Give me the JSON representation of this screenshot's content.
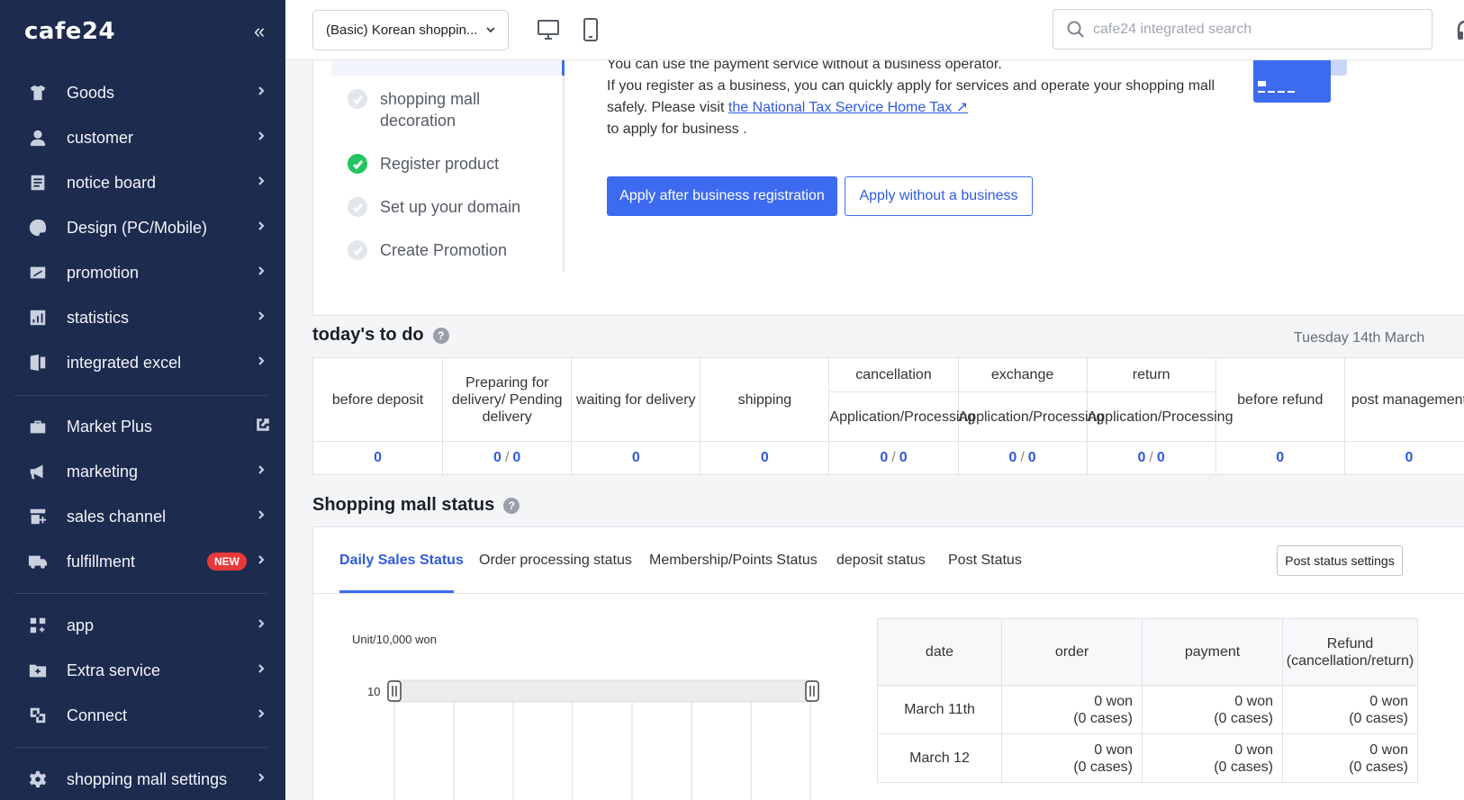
{
  "brand": {
    "logo": "cafe24",
    "collapse": "«"
  },
  "sidebar": {
    "items": [
      {
        "label": "Goods",
        "icon": "shirt-icon"
      },
      {
        "label": "customer",
        "icon": "person-icon"
      },
      {
        "label": "notice board",
        "icon": "board-icon"
      },
      {
        "label": "Design (PC/Mobile)",
        "icon": "palette-icon"
      },
      {
        "label": "promotion",
        "icon": "promotion-icon"
      },
      {
        "label": "statistics",
        "icon": "chart-icon"
      },
      {
        "label": "integrated excel",
        "icon": "excel-icon"
      },
      {
        "label": "Market Plus",
        "icon": "market-icon"
      },
      {
        "label": "marketing",
        "icon": "megaphone-icon"
      },
      {
        "label": "sales channel",
        "icon": "store-icon"
      },
      {
        "label": "fulfillment",
        "icon": "truck-icon",
        "badge": "NEW"
      },
      {
        "label": "app",
        "icon": "apps-icon"
      },
      {
        "label": "Extra service",
        "icon": "folder-plus-icon"
      },
      {
        "label": "Connect",
        "icon": "connect-icon"
      },
      {
        "label": "shopping mall settings",
        "icon": "gear-icon"
      }
    ]
  },
  "topbar": {
    "mall_select": "(Basic) Korean shoppin...",
    "search_placeholder": "cafe24 integrated search"
  },
  "setup": {
    "steps": [
      {
        "label": "shopping mall decoration",
        "done": false
      },
      {
        "label": "Register product",
        "done": true
      },
      {
        "label": "Set up your domain",
        "done": false
      },
      {
        "label": "Create Promotion",
        "done": false
      }
    ],
    "text_line1": "You can use the payment service without a business operator.",
    "text_line2": "If you register as a business, you can quickly apply for services and operate your shopping mall safely. Please visit ",
    "link": "the National Tax Service Home Tax ↗",
    "text_line3": "to apply for business .",
    "btn_primary": "Apply after business registration",
    "btn_outline": "Apply without a business"
  },
  "todo": {
    "title": "today's to do",
    "date": "Tuesday 14th March",
    "columns": [
      {
        "label": "before deposit"
      },
      {
        "label": "Preparing for delivery/ Pending delivery"
      },
      {
        "label": "waiting for delivery"
      },
      {
        "label": "shipping"
      },
      {
        "label": "cancellation",
        "sub": "Application/Processing"
      },
      {
        "label": "exchange",
        "sub": "Application/Processing"
      },
      {
        "label": "return",
        "sub": "Application/Processing"
      },
      {
        "label": "before refund"
      },
      {
        "label": "post management"
      }
    ],
    "values": [
      {
        "a": "0"
      },
      {
        "a": "0",
        "b": "0"
      },
      {
        "a": "0"
      },
      {
        "a": "0"
      },
      {
        "a": "0",
        "b": "0"
      },
      {
        "a": "0",
        "b": "0"
      },
      {
        "a": "0",
        "b": "0"
      },
      {
        "a": "0"
      },
      {
        "a": "0"
      }
    ],
    "slash": "/"
  },
  "status": {
    "title": "Shopping mall status",
    "tabs": [
      "Daily Sales Status",
      "Order processing status",
      "Membership/Points Status",
      "deposit status",
      "Post Status"
    ],
    "post_settings": "Post status settings",
    "unit": "Unit/10,000 won",
    "chart_data": {
      "type": "bar",
      "title": "",
      "ylabel": "Unit/10,000 won",
      "ytick_visible": "10",
      "categories": [],
      "values": []
    },
    "table": {
      "headers": [
        "date",
        "order",
        "payment",
        "Refund (cancellation/return)"
      ],
      "rows": [
        {
          "date": "March 11th",
          "order": "0 won",
          "order_cases": "(0 cases)",
          "payment": "0 won",
          "payment_cases": "(0 cases)",
          "refund": "0 won",
          "refund_cases": "(0 cases)"
        },
        {
          "date": "March 12",
          "order": "0 won",
          "order_cases": "(0 cases)",
          "payment": "0 won",
          "payment_cases": "(0 cases)",
          "refund": "0 won",
          "refund_cases": "(0 cases)"
        }
      ]
    }
  },
  "colors": {
    "sidebar_bg": "#1d2b4f",
    "accent": "#3d6bf0",
    "success": "#22c55e",
    "badge": "#e83a3a"
  }
}
